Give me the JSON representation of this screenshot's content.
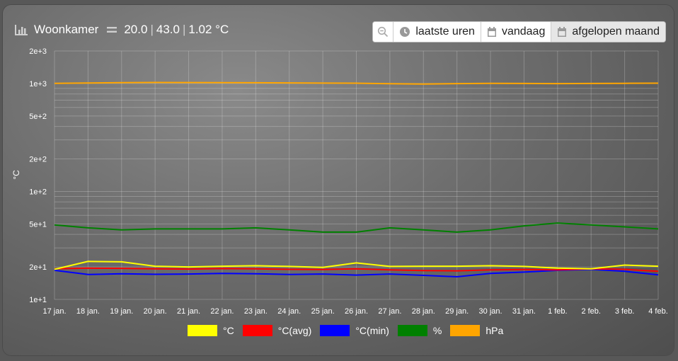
{
  "header": {
    "title": "Woonkamer",
    "values": [
      "20.0",
      "43.0",
      "1.02 °C"
    ],
    "icon": "chart-bar-icon"
  },
  "controls": {
    "zoom_icon": "zoom-out-icon",
    "buttons": [
      {
        "label": "laatste uren",
        "icon": "clock-icon"
      },
      {
        "label": "vandaag",
        "icon": "calendar-icon"
      },
      {
        "label": "afgelopen maand",
        "icon": "calendar-icon",
        "active": true
      }
    ]
  },
  "colors": {
    "temp": "#ffff00",
    "temp_avg": "#ff0000",
    "temp_min": "#0000ff",
    "humidity": "#008000",
    "pressure": "#ffa500"
  },
  "chart_data": {
    "type": "line",
    "ylabel": "°C",
    "yscale": "log",
    "ylim": [
      10,
      2000
    ],
    "yticks": [
      {
        "value": 2000,
        "label": "2e+3"
      },
      {
        "value": 1000,
        "label": "1e+3"
      },
      {
        "value": 500,
        "label": "5e+2"
      },
      {
        "value": 200,
        "label": "2e+2"
      },
      {
        "value": 100,
        "label": "1e+2"
      },
      {
        "value": 50,
        "label": "5e+1"
      },
      {
        "value": 20,
        "label": "2e+1"
      },
      {
        "value": 10,
        "label": "1e+1"
      }
    ],
    "categories": [
      "17 jan.",
      "18 jan.",
      "19 jan.",
      "20 jan.",
      "21 jan.",
      "22 jan.",
      "23 jan.",
      "24 jan.",
      "25 jan.",
      "26 jan.",
      "27 jan.",
      "28 jan.",
      "29 jan.",
      "30 jan.",
      "31 jan.",
      "1 feb.",
      "2 feb.",
      "3 feb.",
      "4 feb."
    ],
    "legend_position": "bottom",
    "grid": true,
    "series": [
      {
        "name": "°C",
        "key": "temp",
        "values": [
          19.0,
          22.5,
          22.3,
          20.3,
          20.0,
          20.3,
          20.5,
          20.2,
          19.8,
          21.8,
          20.2,
          20.3,
          20.3,
          20.5,
          20.2,
          19.5,
          19.2,
          20.8,
          20.3
        ]
      },
      {
        "name": "°C(avg)",
        "key": "temp_avg",
        "values": [
          19.2,
          19.5,
          19.4,
          19.2,
          19.1,
          19.3,
          19.2,
          19.0,
          18.9,
          19.2,
          18.8,
          18.5,
          18.4,
          18.8,
          18.9,
          18.8,
          19.2,
          19.0,
          18.2
        ]
      },
      {
        "name": "°C(min)",
        "key": "temp_min",
        "values": [
          18.6,
          17.0,
          17.3,
          17.1,
          17.2,
          17.4,
          17.3,
          17.0,
          17.2,
          16.8,
          17.2,
          16.7,
          16.2,
          17.4,
          17.9,
          18.6,
          19.0,
          18.2,
          16.9
        ]
      },
      {
        "name": "%",
        "key": "humidity",
        "values": [
          49,
          46,
          44,
          45,
          45,
          45,
          46,
          44,
          42,
          42,
          46,
          44,
          42,
          44,
          48,
          51,
          49,
          47,
          45
        ]
      },
      {
        "name": "hPa",
        "key": "pressure",
        "values": [
          1002,
          1010,
          1018,
          1022,
          1020,
          1018,
          1016,
          1012,
          1008,
          1006,
          996,
          988,
          998,
          1003,
          1000,
          998,
          1000,
          1004,
          1006
        ]
      }
    ]
  }
}
